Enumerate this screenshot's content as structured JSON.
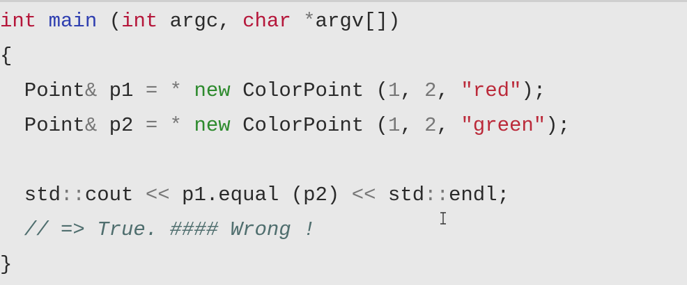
{
  "code_lines": [
    [
      {
        "t": "int",
        "c": "kw"
      },
      {
        "t": " ",
        "c": "plain"
      },
      {
        "t": "main",
        "c": "fn"
      },
      {
        "t": " (",
        "c": "plain"
      },
      {
        "t": "int",
        "c": "kw"
      },
      {
        "t": " argc, ",
        "c": "plain"
      },
      {
        "t": "char",
        "c": "kw"
      },
      {
        "t": " ",
        "c": "plain"
      },
      {
        "t": "*",
        "c": "op"
      },
      {
        "t": "argv[])",
        "c": "plain"
      }
    ],
    [
      {
        "t": "{",
        "c": "plain"
      }
    ],
    [
      {
        "t": "  Point",
        "c": "plain"
      },
      {
        "t": "&",
        "c": "op"
      },
      {
        "t": " p1 ",
        "c": "plain"
      },
      {
        "t": "=",
        "c": "op"
      },
      {
        "t": " ",
        "c": "plain"
      },
      {
        "t": "*",
        "c": "op"
      },
      {
        "t": " ",
        "c": "plain"
      },
      {
        "t": "new",
        "c": "new"
      },
      {
        "t": " ColorPoint (",
        "c": "plain"
      },
      {
        "t": "1",
        "c": "num"
      },
      {
        "t": ", ",
        "c": "plain"
      },
      {
        "t": "2",
        "c": "num"
      },
      {
        "t": ", ",
        "c": "plain"
      },
      {
        "t": "\"red\"",
        "c": "str"
      },
      {
        "t": ");",
        "c": "plain"
      }
    ],
    [
      {
        "t": "  Point",
        "c": "plain"
      },
      {
        "t": "&",
        "c": "op"
      },
      {
        "t": " p2 ",
        "c": "plain"
      },
      {
        "t": "=",
        "c": "op"
      },
      {
        "t": " ",
        "c": "plain"
      },
      {
        "t": "*",
        "c": "op"
      },
      {
        "t": " ",
        "c": "plain"
      },
      {
        "t": "new",
        "c": "new"
      },
      {
        "t": " ColorPoint (",
        "c": "plain"
      },
      {
        "t": "1",
        "c": "num"
      },
      {
        "t": ", ",
        "c": "plain"
      },
      {
        "t": "2",
        "c": "num"
      },
      {
        "t": ", ",
        "c": "plain"
      },
      {
        "t": "\"green\"",
        "c": "str"
      },
      {
        "t": ");",
        "c": "plain"
      }
    ],
    [],
    [
      {
        "t": "  std",
        "c": "plain"
      },
      {
        "t": "::",
        "c": "op"
      },
      {
        "t": "cout ",
        "c": "plain"
      },
      {
        "t": "<<",
        "c": "op"
      },
      {
        "t": " p1.equal (p2) ",
        "c": "plain"
      },
      {
        "t": "<<",
        "c": "op"
      },
      {
        "t": " std",
        "c": "plain"
      },
      {
        "t": "::",
        "c": "op"
      },
      {
        "t": "endl;",
        "c": "plain"
      }
    ],
    [
      {
        "t": "  // => True. #### Wrong !",
        "c": "comment"
      }
    ],
    [
      {
        "t": "}",
        "c": "plain"
      }
    ]
  ],
  "colors": {
    "background": "#e8e8e8",
    "keyword": "#b5163a",
    "function": "#2f3fb0",
    "new_keyword": "#2d8a2d",
    "string": "#bb2a3a",
    "number": "#777777",
    "operator": "#777777",
    "text": "#2a2a2a",
    "comment": "#4f6e6e"
  },
  "cursor_icon": "text-cursor-ibeam-icon"
}
